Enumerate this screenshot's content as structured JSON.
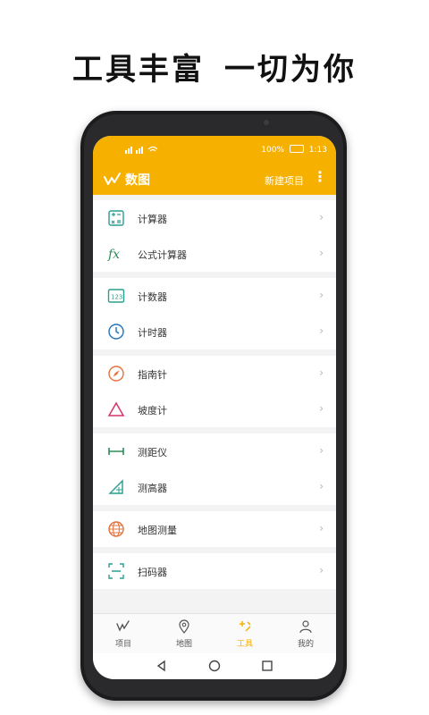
{
  "headline": {
    "left": "工具丰富",
    "right": "一切为你"
  },
  "status": {
    "left": "…",
    "right_battery": "100%",
    "time": "1:13"
  },
  "appbar": {
    "title": "数图",
    "new_project": "新建项目",
    "more_glyph": "⋮"
  },
  "groups": [
    [
      {
        "label": "计算器",
        "icon": "calculator-icon"
      },
      {
        "label": "公式计算器",
        "icon": "fx-icon"
      }
    ],
    [
      {
        "label": "计数器",
        "icon": "counter-123-icon"
      },
      {
        "label": "计时器",
        "icon": "clock-icon"
      }
    ],
    [
      {
        "label": "指南针",
        "icon": "compass-icon"
      },
      {
        "label": "坡度计",
        "icon": "triangle-icon"
      }
    ],
    [
      {
        "label": "测距仪",
        "icon": "ruler-icon"
      },
      {
        "label": "测高器",
        "icon": "height-icon"
      }
    ],
    [
      {
        "label": "地图测量",
        "icon": "globe-icon"
      }
    ],
    [
      {
        "label": "扫码器",
        "icon": "scan-icon"
      }
    ]
  ],
  "chevron": "›",
  "nav": [
    {
      "label": "项目",
      "icon": "project-logo-icon"
    },
    {
      "label": "地图",
      "icon": "location-pin-icon"
    },
    {
      "label": "工具",
      "icon": "tools-icon",
      "active": true
    },
    {
      "label": "我的",
      "icon": "person-icon"
    }
  ],
  "colors": {
    "accent": "#f6b000",
    "icon_teal": "#2a9d8f",
    "icon_blue": "#1e73be",
    "icon_orange": "#e8703a",
    "icon_pink": "#d6336c",
    "icon_green": "#2e8b57"
  }
}
